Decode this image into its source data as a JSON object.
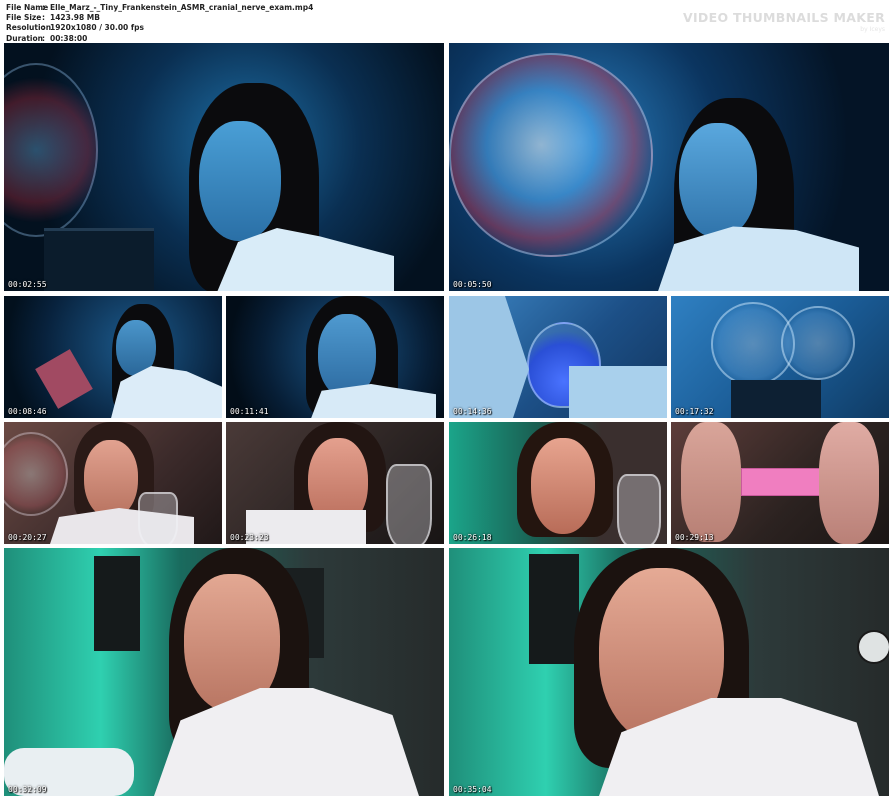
{
  "file_info": {
    "file_name_label": "File Name",
    "file_name_value": "Elle_Marz_-_Tiny_Frankenstein_ASMR_cranial_nerve_exam.mp4",
    "file_size_label": "File Size",
    "file_size_value": "1423.98 MB",
    "resolution_label": "Resolution",
    "resolution_value": "1920x1080 / 30.00 fps",
    "duration_label": "Duration",
    "duration_value": "00:38:00",
    "separator": ":"
  },
  "brand": {
    "title": "VIDEO THUMBNAILS MAKER",
    "subtitle": "by Iceys"
  },
  "thumbnails": [
    {
      "timestamp": "00:02:55"
    },
    {
      "timestamp": "00:05:50"
    },
    {
      "timestamp": "00:08:46"
    },
    {
      "timestamp": "00:11:41"
    },
    {
      "timestamp": "00:14:36"
    },
    {
      "timestamp": "00:17:32"
    },
    {
      "timestamp": "00:20:27"
    },
    {
      "timestamp": "00:23:23"
    },
    {
      "timestamp": "00:26:18"
    },
    {
      "timestamp": "00:29:13"
    },
    {
      "timestamp": "00:32:09"
    },
    {
      "timestamp": "00:35:04"
    }
  ],
  "colors": {
    "blue_scene": "#0c3a66",
    "teal_scene": "#1aa58a",
    "warm_scene": "#8a5a4a"
  }
}
